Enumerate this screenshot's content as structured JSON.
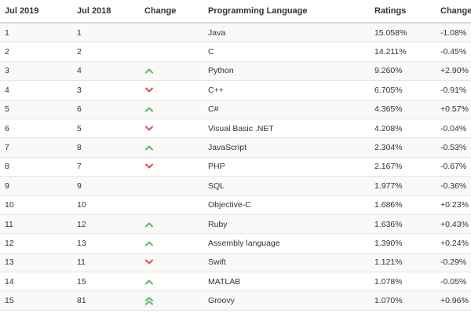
{
  "columns": [
    "Jul 2019",
    "Jul 2018",
    "Change",
    "Programming Language",
    "Ratings",
    "Change"
  ],
  "colors": {
    "up": "#5cb85c",
    "down": "#d9534f"
  },
  "rows": [
    {
      "now": "1",
      "prev": "1",
      "trend": "none",
      "lang": "Java",
      "rating": "15.058%",
      "change": "-1.08%"
    },
    {
      "now": "2",
      "prev": "2",
      "trend": "none",
      "lang": "C",
      "rating": "14.211%",
      "change": "-0.45%"
    },
    {
      "now": "3",
      "prev": "4",
      "trend": "up",
      "lang": "Python",
      "rating": "9.260%",
      "change": "+2.90%"
    },
    {
      "now": "4",
      "prev": "3",
      "trend": "down",
      "lang": "C++",
      "rating": "6.705%",
      "change": "-0.91%"
    },
    {
      "now": "5",
      "prev": "6",
      "trend": "up",
      "lang": "C#",
      "rating": "4.365%",
      "change": "+0.57%"
    },
    {
      "now": "6",
      "prev": "5",
      "trend": "down",
      "lang": "Visual Basic .NET",
      "rating": "4.208%",
      "change": "-0.04%"
    },
    {
      "now": "7",
      "prev": "8",
      "trend": "up",
      "lang": "JavaScript",
      "rating": "2.304%",
      "change": "-0.53%"
    },
    {
      "now": "8",
      "prev": "7",
      "trend": "down",
      "lang": "PHP",
      "rating": "2.167%",
      "change": "-0.67%"
    },
    {
      "now": "9",
      "prev": "9",
      "trend": "none",
      "lang": "SQL",
      "rating": "1.977%",
      "change": "-0.36%"
    },
    {
      "now": "10",
      "prev": "10",
      "trend": "none",
      "lang": "Objective-C",
      "rating": "1.686%",
      "change": "+0.23%"
    },
    {
      "now": "11",
      "prev": "12",
      "trend": "up",
      "lang": "Ruby",
      "rating": "1.636%",
      "change": "+0.43%"
    },
    {
      "now": "12",
      "prev": "13",
      "trend": "up",
      "lang": "Assembly language",
      "rating": "1.390%",
      "change": "+0.24%"
    },
    {
      "now": "13",
      "prev": "11",
      "trend": "down",
      "lang": "Swift",
      "rating": "1.121%",
      "change": "-0.29%"
    },
    {
      "now": "14",
      "prev": "15",
      "trend": "up",
      "lang": "MATLAB",
      "rating": "1.078%",
      "change": "-0.05%"
    },
    {
      "now": "15",
      "prev": "81",
      "trend": "double-up",
      "lang": "Groovy",
      "rating": "1.070%",
      "change": "+0.96%"
    }
  ]
}
